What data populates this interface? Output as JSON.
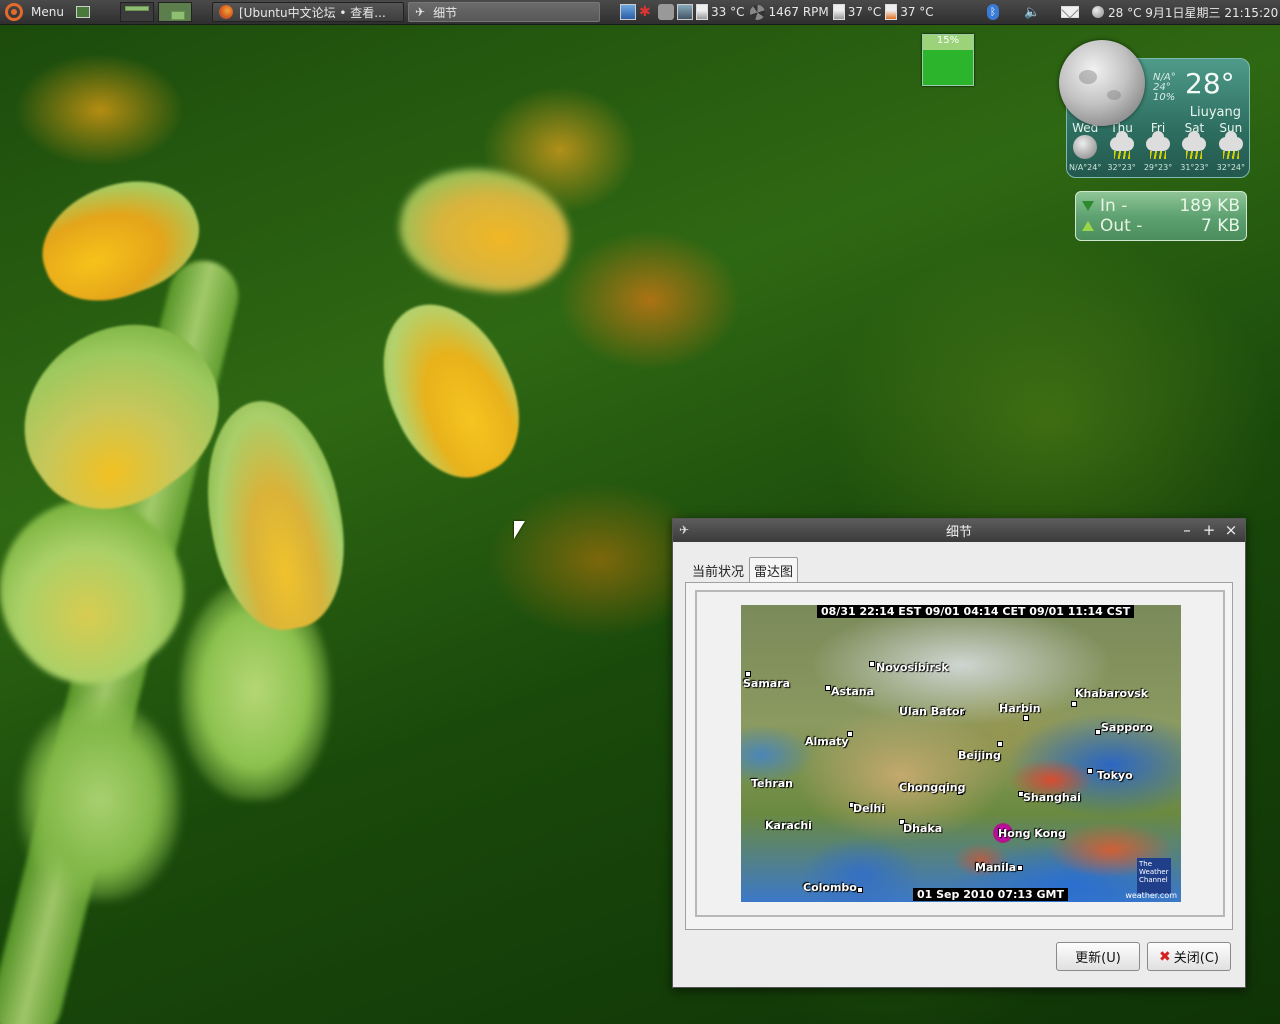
{
  "panel": {
    "menu_label": "Menu",
    "tasks": [
      {
        "label": "[Ubuntu中文论坛 • 查看...",
        "icon": "firefox-icon"
      },
      {
        "label": "细节",
        "icon": "weather-icon"
      }
    ],
    "sensors": {
      "cpu_temp": "33 °C",
      "fan": "1467 RPM",
      "disk1_temp": "37 °C",
      "disk2_temp": "37 °C"
    },
    "clock": "28 °C 9月1日星期三 21:15:20"
  },
  "cpu_widget": {
    "label": "15%"
  },
  "weather_widget": {
    "small_line1": "N/A°",
    "small_line2": "24°",
    "small_line3": "10%",
    "temp": "28°",
    "city": "Liuyang",
    "days": [
      {
        "name": "Wed",
        "hl": "N/A°24°",
        "icon": "moon-icon"
      },
      {
        "name": "Thu",
        "hl": "32°23°",
        "icon": "storm-icon"
      },
      {
        "name": "Fri",
        "hl": "29°23°",
        "icon": "storm-icon"
      },
      {
        "name": "Sat",
        "hl": "31°23°",
        "icon": "storm-icon"
      },
      {
        "name": "Sun",
        "hl": "32°24°",
        "icon": "storm-icon"
      }
    ]
  },
  "net_widget": {
    "in_label": "In -",
    "in_value": "189 KB",
    "out_label": "Out -",
    "out_value": "7 KB"
  },
  "dialog": {
    "title": "细节",
    "tabs": [
      "当前状况",
      "雷达图"
    ],
    "active_tab": 1,
    "radar": {
      "stamp_top": "08/31 22:14 EST  09/01 04:14 CET  09/01 11:14 CST",
      "stamp_bottom": "01 Sep 2010 07:13 GMT",
      "logo": "The Weather Channel",
      "site": "weather.com",
      "cities": [
        "Samara",
        "Novosibirsk",
        "Astana",
        "Khabarovsk",
        "Ulan Bator",
        "Harbin",
        "Sapporo",
        "Almaty",
        "Beijing",
        "Tokyo",
        "Tehran",
        "Chongqing",
        "Shanghai",
        "Delhi",
        "Karachi",
        "Dhaka",
        "Hong Kong",
        "Manila",
        "Colombo"
      ]
    },
    "buttons": {
      "refresh": "更新(U)",
      "close": "关闭(C)"
    }
  }
}
